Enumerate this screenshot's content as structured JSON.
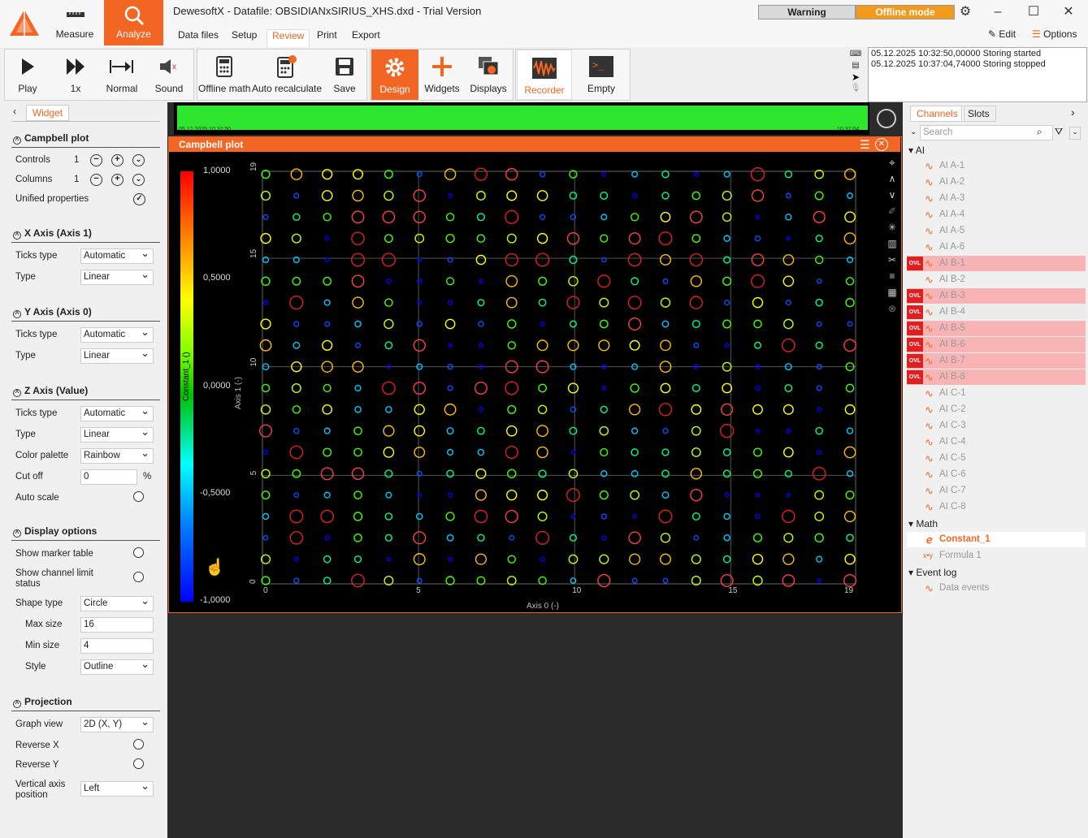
{
  "app": {
    "title": "DewesoftX - Datafile: OBSIDIANxSIRIUS_XHS.dxd - Trial Version",
    "mode_buttons": [
      "Measure",
      "Analyze"
    ],
    "menus": [
      "Data files",
      "Setup",
      "Review",
      "Print",
      "Export"
    ],
    "warning": "Warning",
    "offline": "Offline mode",
    "edit": "Edit",
    "options": "Options"
  },
  "toolbar": {
    "play": "Play",
    "speed": "1x",
    "normal": "Normal",
    "sound": "Sound",
    "offline_math": "Offline math",
    "auto_recalc": "Auto recalculate",
    "save": "Save",
    "design": "Design",
    "widgets": "Widgets",
    "displays": "Displays",
    "recorder": "Recorder",
    "empty": "Empty"
  },
  "log": [
    "05.12.2025 10:32:50,00000 Storing started",
    "05.12.2025 10:37:04,74000 Storing stopped"
  ],
  "leftpanel": {
    "tab": "Widget",
    "campbell": {
      "title": "Campbell plot",
      "controls_label": "Controls",
      "controls_value": "1",
      "columns_label": "Columns",
      "columns_value": "1",
      "unified": "Unified properties"
    },
    "xaxis": {
      "title": "X Axis (Axis 1)",
      "ticks_label": "Ticks type",
      "ticks_value": "Automatic",
      "type_label": "Type",
      "type_value": "Linear"
    },
    "yaxis": {
      "title": "Y Axis (Axis 0)",
      "ticks_label": "Ticks type",
      "ticks_value": "Automatic",
      "type_label": "Type",
      "type_value": "Linear"
    },
    "zaxis": {
      "title": "Z Axis (Value)",
      "ticks_label": "Ticks type",
      "ticks_value": "Automatic",
      "type_label": "Type",
      "type_value": "Linear",
      "palette_label": "Color palette",
      "palette_value": "Rainbow",
      "cutoff_label": "Cut off",
      "cutoff_value": "0",
      "cutoff_unit": "%",
      "autoscale": "Auto scale"
    },
    "display": {
      "title": "Display options",
      "marker_table": "Show marker table",
      "channel_limit": "Show channel limit status",
      "shape_label": "Shape type",
      "shape_value": "Circle",
      "max_label": "Max size",
      "max_value": "16",
      "min_label": "Min size",
      "min_value": "4",
      "style_label": "Style",
      "style_value": "Outline"
    },
    "projection": {
      "title": "Projection",
      "graph_label": "Graph view",
      "graph_value": "2D (X, Y)",
      "revx": "Reverse X",
      "revy": "Reverse Y",
      "vaxis_label": "Vertical axis position",
      "vaxis_value": "Left"
    }
  },
  "plot": {
    "title": "Campbell plot",
    "x_axis_label": "Axis 0 (-)",
    "y_axis_label": "Axis 1 (-)",
    "colorbar_label": "Constant_1 ()",
    "colorbar_ticks": [
      "1,0000",
      "0,5000",
      "0,0000",
      "-0,5000",
      "-1,0000"
    ],
    "x_ticks": [
      "0",
      "5",
      "10",
      "15",
      "19"
    ],
    "y_ticks": [
      "0",
      "5",
      "10",
      "15",
      "19"
    ],
    "strip_left": "05.12.2025 10:32:50",
    "strip_right": "10:37:04"
  },
  "rightpanel": {
    "tabs": [
      "Channels",
      "Slots"
    ],
    "search_placeholder": "Search",
    "groups": {
      "ai": "AI",
      "math": "Math",
      "eventlog": "Event log"
    },
    "ai_channels": [
      "AI A-1",
      "AI A-2",
      "AI A-3",
      "AI A-4",
      "AI A-5",
      "AI A-6",
      "AI B-1",
      "AI B-2",
      "AI B-3",
      "AI B-4",
      "AI B-5",
      "AI B-6",
      "AI B-7",
      "AI B-8",
      "AI C-1",
      "AI C-2",
      "AI C-3",
      "AI C-4",
      "AI C-5",
      "AI C-6",
      "AI C-7",
      "AI C-8"
    ],
    "ovl_text": "OVL",
    "math_channels": [
      "Constant_1",
      "Formula 1"
    ],
    "event_channels": [
      "Data events"
    ]
  },
  "chart_data": {
    "type": "scatter",
    "title": "Campbell plot",
    "xlabel": "Axis 0 (-)",
    "ylabel": "Axis 1 (-)",
    "xlim": [
      0,
      19
    ],
    "ylim": [
      0,
      19
    ],
    "zlabel": "Constant_1 ()",
    "zlim": [
      -1,
      1
    ],
    "palette": "Rainbow",
    "marker": "circle outline",
    "grid_x_count": 20,
    "grid_y_count": 20
  }
}
